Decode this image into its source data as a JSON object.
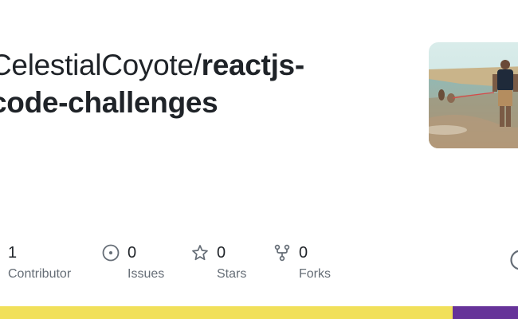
{
  "repo": {
    "owner": "CelestialCoyote/",
    "name_line1": "reactjs-",
    "name_line2": "code-challenges"
  },
  "stats": [
    {
      "icon": "contributor-icon",
      "value": "1",
      "label": "Contributor"
    },
    {
      "icon": "issue-icon",
      "value": "0",
      "label": "Issues"
    },
    {
      "icon": "star-icon",
      "value": "0",
      "label": "Stars"
    },
    {
      "icon": "fork-icon",
      "value": "0",
      "label": "Forks"
    }
  ],
  "language_bar": [
    {
      "color": "#f1e05a",
      "share": 0.874
    },
    {
      "color": "#663399",
      "share": 0.126
    }
  ]
}
